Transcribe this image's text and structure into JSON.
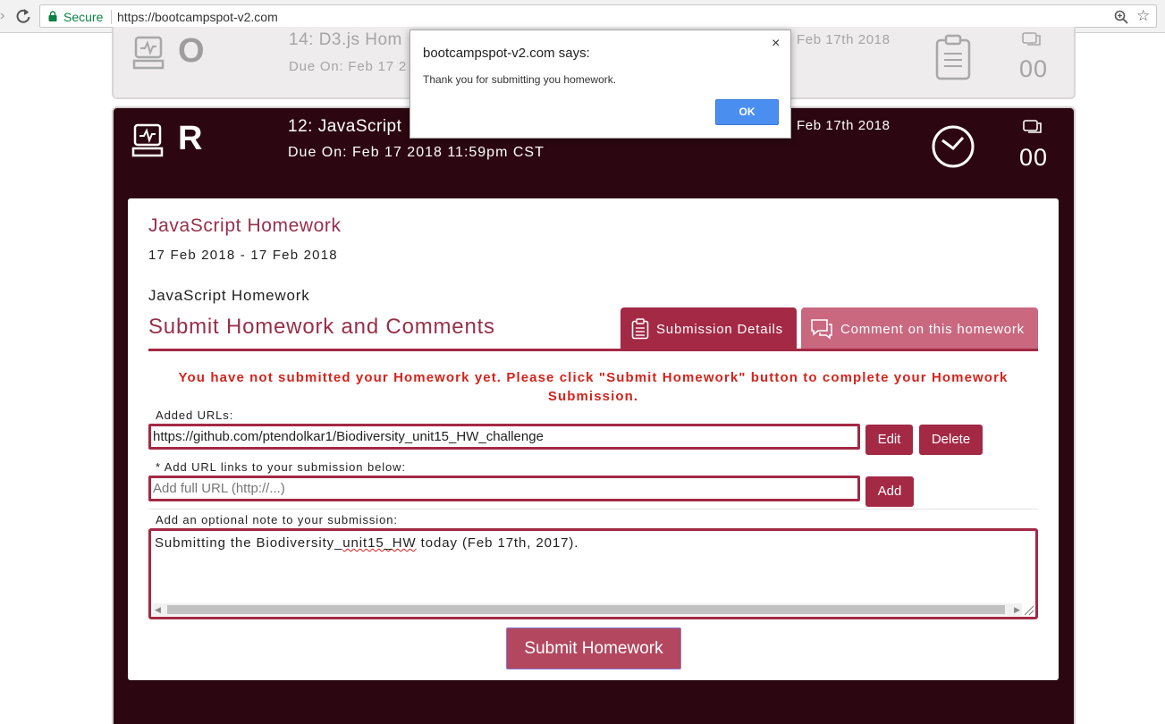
{
  "browser": {
    "secure_label": "Secure",
    "url": "https://bootcampspot-v2.com"
  },
  "faded_card": {
    "letter": "O",
    "title": "14: D3.js Hom",
    "due": "Due On: Feb 17 2",
    "date_right": "Feb 17th 2018",
    "comment_count": "00"
  },
  "active_card": {
    "letter": "R",
    "title": "12: JavaScript",
    "due": "Due On: Feb 17 2018 11:59pm CST",
    "date_right": "Feb 17th 2018",
    "comment_count": "00"
  },
  "homework": {
    "title": "JavaScript Homework",
    "dates": "17 Feb 2018 - 17 Feb 2018",
    "name": "JavaScript Homework",
    "section_title": "Submit Homework and Comments"
  },
  "tabs": {
    "submission_details": "Submission Details",
    "comment": "Comment on this homework"
  },
  "warning": "You have not submitted your Homework yet. Please click \"Submit Homework\" button to complete your Homework Submission.",
  "form": {
    "added_urls_label": "Added URLs:",
    "added_url_value": "https://github.com/ptendolkar1/Biodiversity_unit15_HW_challenge",
    "edit_label": "Edit",
    "delete_label": "Delete",
    "add_url_label": "* Add URL links to your submission below:",
    "add_url_placeholder": "Add full URL (http://...)",
    "add_label": "Add",
    "note_label": "Add an optional note to your submission:",
    "note_text_before": "Submitting the Biodiversity_",
    "note_text_misspelled": "unit15_HW",
    "note_text_after": " today (Feb 17th, 2017).",
    "submit_label": "Submit Homework"
  },
  "dialog": {
    "title": "bootcampspot-v2.com says:",
    "close": "×",
    "message": "Thank you for submitting you homework.",
    "ok_label": "OK"
  },
  "colors": {
    "brand": "#a32945",
    "dark_bg": "#2c0711",
    "warning": "#d3241c",
    "dialog_ok": "#4a8ef0"
  }
}
